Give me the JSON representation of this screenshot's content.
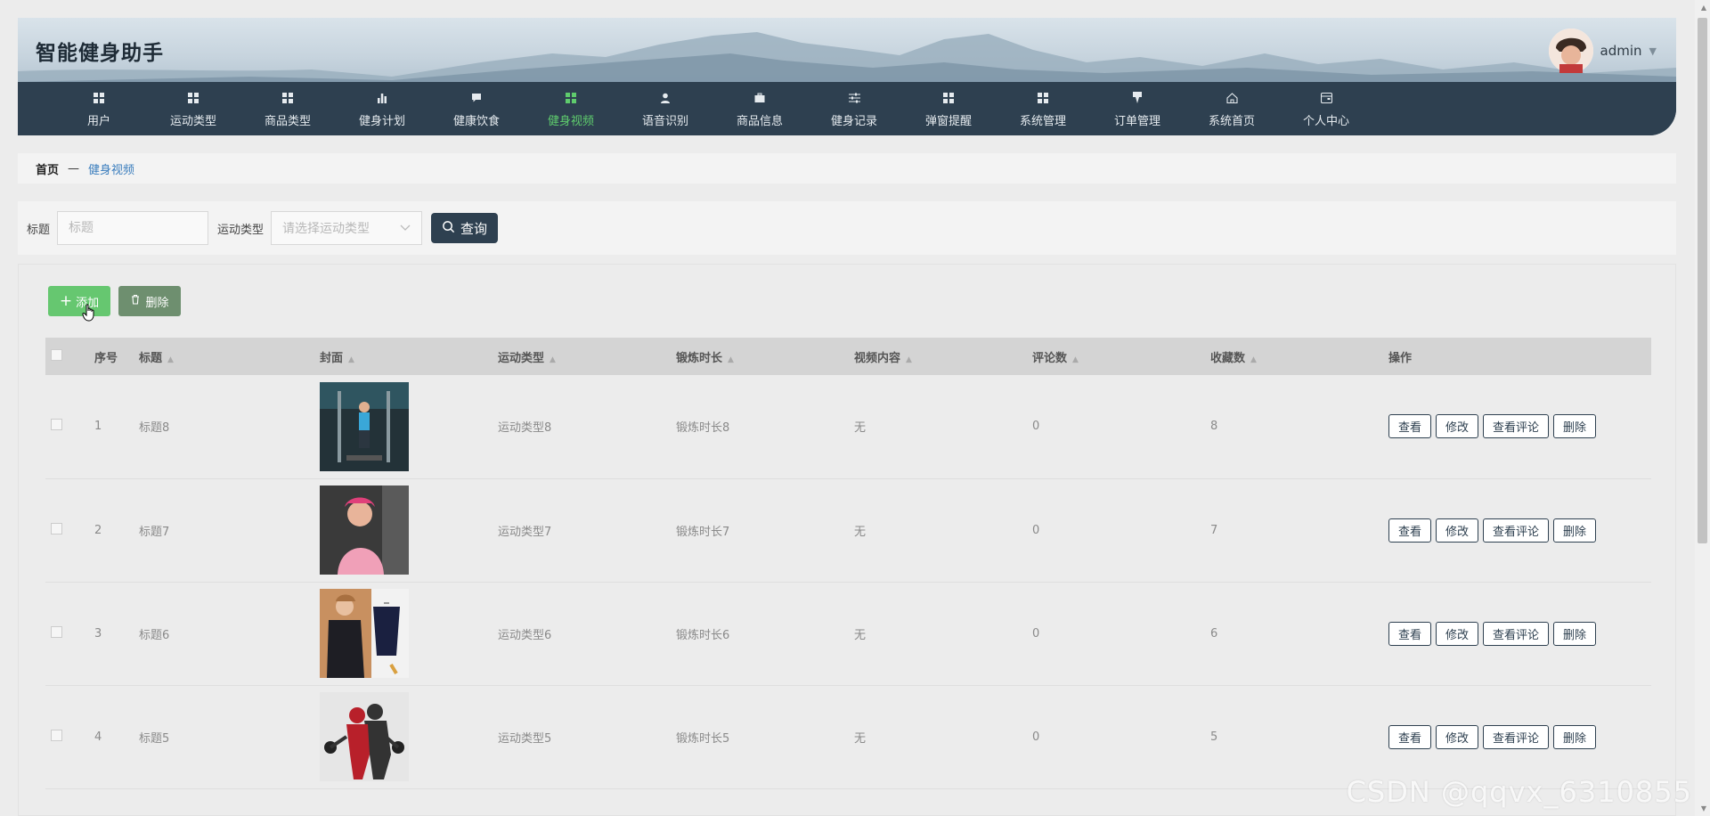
{
  "app": {
    "title": "智能健身助手",
    "username": "admin"
  },
  "nav": [
    {
      "label": "用户",
      "icon": "grid-icon"
    },
    {
      "label": "运动类型",
      "icon": "grid-icon"
    },
    {
      "label": "商品类型",
      "icon": "grid-icon"
    },
    {
      "label": "健身计划",
      "icon": "bar-chart-icon"
    },
    {
      "label": "健康饮食",
      "icon": "chat-icon"
    },
    {
      "label": "健身视频",
      "icon": "grid-icon",
      "active": true
    },
    {
      "label": "语音识别",
      "icon": "user-icon"
    },
    {
      "label": "商品信息",
      "icon": "briefcase-icon"
    },
    {
      "label": "健身记录",
      "icon": "sliders-icon"
    },
    {
      "label": "弹窗提醒",
      "icon": "grid-icon"
    },
    {
      "label": "系统管理",
      "icon": "grid-icon"
    },
    {
      "label": "订单管理",
      "icon": "pin-icon"
    },
    {
      "label": "系统首页",
      "icon": "home-icon"
    },
    {
      "label": "个人中心",
      "icon": "window-icon"
    }
  ],
  "breadcrumb": {
    "home": "首页",
    "separator": "—",
    "current": "健身视频"
  },
  "search": {
    "title_label": "标题",
    "title_placeholder": "标题",
    "type_label": "运动类型",
    "type_placeholder": "请选择运动类型",
    "query_label": "查询"
  },
  "actions": {
    "add_label": "添加",
    "delete_label": "删除"
  },
  "table": {
    "headers": [
      "序号",
      "标题",
      "封面",
      "运动类型",
      "锻炼时长",
      "视频内容",
      "评论数",
      "收藏数",
      "操作"
    ],
    "rows": [
      {
        "index": "1",
        "title": "标题8",
        "type": "运动类型8",
        "duration": "锻炼时长8",
        "content": "无",
        "comments": "0",
        "favorites": "8"
      },
      {
        "index": "2",
        "title": "标题7",
        "type": "运动类型7",
        "duration": "锻炼时长7",
        "content": "无",
        "comments": "0",
        "favorites": "7"
      },
      {
        "index": "3",
        "title": "标题6",
        "type": "运动类型6",
        "duration": "锻炼时长6",
        "content": "无",
        "comments": "0",
        "favorites": "6"
      },
      {
        "index": "4",
        "title": "标题5",
        "type": "运动类型5",
        "duration": "锻炼时长5",
        "content": "无",
        "comments": "0",
        "favorites": "5"
      }
    ],
    "op_labels": {
      "view": "查看",
      "edit": "修改",
      "view_comments": "查看评论",
      "delete": "删除"
    }
  },
  "watermark": "CSDN @qqvx_6310855",
  "colors": {
    "nav_bg": "#2e4050",
    "active": "#5fcc6d",
    "add_btn": "#66c770",
    "del_btn": "#6e8f6f",
    "link": "#3a7dbd"
  }
}
